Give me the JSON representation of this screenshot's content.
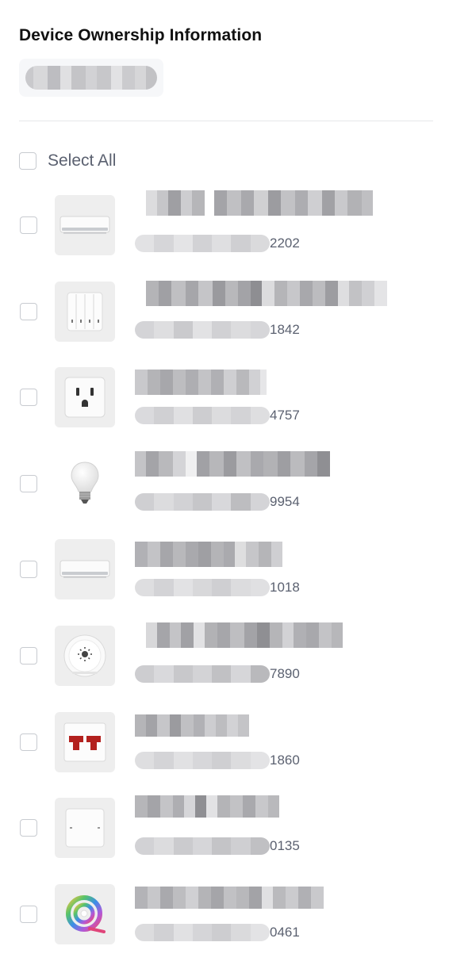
{
  "header": {
    "title": "Device Ownership Information"
  },
  "select_all": {
    "label": "Select All"
  },
  "devices": [
    {
      "icon": "air-conditioner-icon",
      "id_suffix": "2202"
    },
    {
      "icon": "four-gang-switch-icon",
      "id_suffix": "1842"
    },
    {
      "icon": "wall-socket-icon",
      "id_suffix": "4757"
    },
    {
      "icon": "light-bulb-icon",
      "id_suffix": "9954"
    },
    {
      "icon": "air-conditioner-icon",
      "id_suffix": "1018"
    },
    {
      "icon": "light-sensor-icon",
      "id_suffix": "7890"
    },
    {
      "icon": "dual-switch-icon",
      "id_suffix": "1860"
    },
    {
      "icon": "single-switch-icon",
      "id_suffix": "0135"
    },
    {
      "icon": "light-strip-icon",
      "id_suffix": "0461"
    }
  ]
}
